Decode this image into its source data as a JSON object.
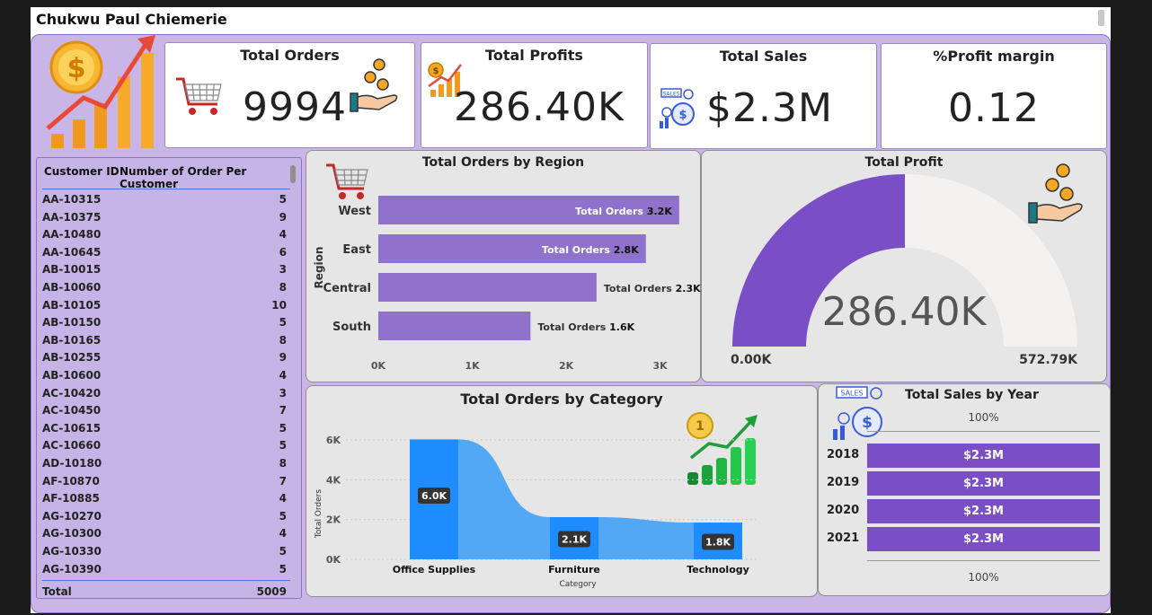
{
  "page_title": "Chukwu Paul Chiemerie",
  "kpis": {
    "orders": {
      "title": "Total Orders",
      "value": "9994"
    },
    "profits": {
      "title": "Total Profits",
      "value": "286.40K"
    },
    "sales": {
      "title": "Total Sales",
      "value": "$2.3M"
    },
    "margin": {
      "title": "%Profit margin",
      "value": "0.12"
    }
  },
  "table": {
    "headers": [
      "Customer ID",
      "Number of Order Per Customer"
    ],
    "rows": [
      [
        "AA-10315",
        "5"
      ],
      [
        "AA-10375",
        "9"
      ],
      [
        "AA-10480",
        "4"
      ],
      [
        "AA-10645",
        "6"
      ],
      [
        "AB-10015",
        "3"
      ],
      [
        "AB-10060",
        "8"
      ],
      [
        "AB-10105",
        "10"
      ],
      [
        "AB-10150",
        "5"
      ],
      [
        "AB-10165",
        "8"
      ],
      [
        "AB-10255",
        "9"
      ],
      [
        "AB-10600",
        "4"
      ],
      [
        "AC-10420",
        "3"
      ],
      [
        "AC-10450",
        "7"
      ],
      [
        "AC-10615",
        "5"
      ],
      [
        "AC-10660",
        "5"
      ],
      [
        "AD-10180",
        "8"
      ],
      [
        "AF-10870",
        "7"
      ],
      [
        "AF-10885",
        "4"
      ],
      [
        "AG-10270",
        "5"
      ],
      [
        "AG-10300",
        "4"
      ],
      [
        "AG-10330",
        "5"
      ],
      [
        "AG-10390",
        "5"
      ]
    ],
    "total_label": "Total",
    "total_value": "5009"
  },
  "region_chart": {
    "title": "Total Orders by Region",
    "ylabel": "Region",
    "ticks": [
      "0K",
      "1K",
      "2K",
      "3K"
    ],
    "labels": [
      "Total Orders 3.2K",
      "Total Orders 2.8K",
      "Total Orders 2.3K",
      "Total Orders 1.6K"
    ]
  },
  "gauge": {
    "title": "Total Profit",
    "value_label": "286.40K",
    "min_label": "0.00K",
    "max_label": "572.79K",
    "value": 286.4,
    "min": 0,
    "max": 572.79,
    "fill_color": "#7a4fc6"
  },
  "category_chart": {
    "title": "Total Orders by Category",
    "ylabel": "Total Orders",
    "xlabel": "Category",
    "ticks": [
      "0K",
      "2K",
      "4K",
      "6K"
    ],
    "labels": [
      "6.0K",
      "2.1K",
      "1.8K"
    ]
  },
  "sales_by_year": {
    "title": "Total Sales by Year",
    "top_label": "100%",
    "bottom_label": "100%",
    "years": [
      {
        "year": "2018",
        "value": "$2.3M"
      },
      {
        "year": "2019",
        "value": "$2.3M"
      },
      {
        "year": "2020",
        "value": "$2.3M"
      },
      {
        "year": "2021",
        "value": "$2.3M"
      }
    ]
  },
  "chart_data": [
    {
      "type": "bar",
      "title": "Total Orders by Region",
      "ylabel": "Region",
      "categories": [
        "West",
        "East",
        "Central",
        "South"
      ],
      "values": [
        3203,
        2848,
        2323,
        1620
      ],
      "xlim": [
        0,
        3300
      ],
      "orientation": "horizontal",
      "color": "#8e72cc"
    },
    {
      "type": "area",
      "title": "Total Orders by Category",
      "xlabel": "Category",
      "ylabel": "Total Orders",
      "categories": [
        "Office Supplies",
        "Furniture",
        "Technology"
      ],
      "values": [
        6026,
        2121,
        1847
      ],
      "ylim": [
        0,
        6500
      ],
      "color": "#1e8cff"
    }
  ],
  "colors": {
    "accent": "#7a4fc6",
    "bar": "#8e72cc",
    "blue": "#1e8cff",
    "blue_light": "#52a8f5",
    "board": "#c9b6e6"
  },
  "icons": [
    "money-growth-icon",
    "shopping-cart-icon",
    "coins-hand-icon",
    "profit-chart-icon",
    "sales-icon",
    "gold-coin-growth-icon"
  ]
}
